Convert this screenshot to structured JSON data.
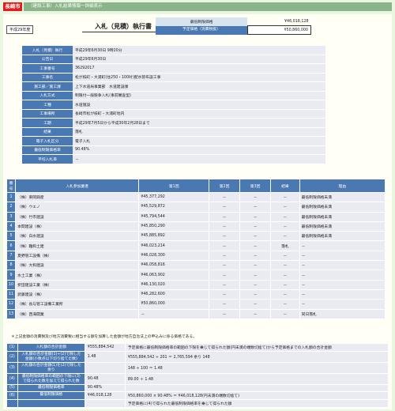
{
  "header": {
    "city": "長崎市",
    "title": "（建設工事）入札結果情報一詳細表示"
  },
  "document": {
    "year": "平成29年度",
    "title": "入札（見積）執行書"
  },
  "prices": {
    "min_label": "最低制限価格",
    "min_value": "¥46,018,128",
    "planned_label": "予定価格（消費税抜）",
    "planned_value": "¥50,860,000"
  },
  "info_rows": [
    {
      "label": "入札（見積）執行",
      "value": "平成29年6月30日 9時20分"
    },
    {
      "label": "公告日",
      "value": "平成29年6月30日"
    },
    {
      "label": "工事番号",
      "value": "36292017"
    },
    {
      "label": "工事名",
      "value": "松が枝町・大浦町(住250・100吋)配水管布設工事"
    },
    {
      "label": "施工部／施工課",
      "value": "上下水道局事業部　水道建設課"
    },
    {
      "label": "入札方式",
      "value": "制限付一般競争入札(事前審査型)"
    },
    {
      "label": "工種",
      "value": "水道施設"
    },
    {
      "label": "工事場所",
      "value": "長崎市松が枝町・大浦町地内"
    },
    {
      "label": "工期",
      "value": "平成29年7月5日から平成30年2月28日まで"
    },
    {
      "label": "結果",
      "value": "落札"
    },
    {
      "label": "電子入札区分",
      "value": "電子入札"
    },
    {
      "label": "最低制限価格率",
      "value": "90.48%"
    },
    {
      "label": "平均入札率",
      "value": "－"
    }
  ],
  "bids": {
    "headers": [
      "番号",
      "入札参加業者",
      "第1回",
      "第2回",
      "第3回",
      "結果",
      "理由"
    ],
    "rows": [
      {
        "no": "1",
        "name": "（株）東岡興産",
        "r1": "¥45,377,292",
        "r2": "－",
        "r3": "－",
        "result": "－",
        "reason": "最低制限価格未満"
      },
      {
        "no": "2",
        "name": "（株）ウエノ",
        "r1": "¥45,529,872",
        "r2": "－",
        "r3": "－",
        "result": "－",
        "reason": "最低制限価格未満"
      },
      {
        "no": "3",
        "name": "（株）竹市建設",
        "r1": "¥45,794,544",
        "r2": "－",
        "r3": "－",
        "result": "－",
        "reason": "最低制限価格未満"
      },
      {
        "no": "4",
        "name": "本間建設（株）",
        "r1": "¥45,850,290",
        "r2": "－",
        "r3": "－",
        "result": "－",
        "reason": "最低制限価格未満"
      },
      {
        "no": "5",
        "name": "（株）白水建設",
        "r1": "¥45,885,892",
        "r2": "－",
        "r3": "－",
        "result": "－",
        "reason": "最低制限価格未満"
      },
      {
        "no": "6",
        "name": "（株）難和土建",
        "r1": "¥46,023,214",
        "r2": "－",
        "r3": "－",
        "result": "落札",
        "reason": "－"
      },
      {
        "no": "7",
        "name": "夏野管工設備（株）",
        "r1": "¥46,028,300",
        "r2": "－",
        "r3": "－",
        "result": "－",
        "reason": "－"
      },
      {
        "no": "8",
        "name": "（株）大和建設",
        "r1": "¥46,058,816",
        "r2": "－",
        "r3": "－",
        "result": "－",
        "reason": "－"
      },
      {
        "no": "9",
        "name": "水土工業（株）",
        "r1": "¥46,063,902",
        "r2": "－",
        "r3": "－",
        "result": "－",
        "reason": "－"
      },
      {
        "no": "10",
        "name": "折田建設工業（株）",
        "r1": "¥46,130,020",
        "r2": "－",
        "r3": "－",
        "result": "－",
        "reason": "－"
      },
      {
        "no": "11",
        "name": "武藤建設（株）",
        "r1": "¥46,282,600",
        "r2": "－",
        "r3": "－",
        "result": "－",
        "reason": "－"
      },
      {
        "no": "12",
        "name": "（株）長与管工設備工業所",
        "r1": "¥50,860,000",
        "r2": "－",
        "r3": "－",
        "result": "－",
        "reason": "－"
      },
      {
        "no": "13",
        "name": "（株）西海開業",
        "r1": "－",
        "r2": "－",
        "r3": "－",
        "result": "－",
        "reason": "同日落札"
      }
    ]
  },
  "note": "＊上記金額の消費税及び地方消費税に相当する額を加算した金額が地方自治法上の申込みに係る価格である。",
  "calc": [
    {
      "no": "(1)",
      "label": "入札額の合計金額",
      "value": "¥555,884,542",
      "detail": "予定価格に最低制限価格率の範囲の下限を乗じて得られた額(円未満の端数切捨て)から予定価格までの入札額の合計金額"
    },
    {
      "no": "(2)",
      "label": "入札額の合計金額(1)÷(2)で除した金額(小数点以下切り捨てた数)",
      "value": "1.48",
      "detail": "¥555,884,542 ÷ 201 ＝ 2,765,594 余り 148"
    },
    {
      "no": "(3)",
      "label": "入札額の合計金額(1)を(2)で除した余り",
      "value": "",
      "detail": "148 ÷ 100 ＝ 1.48"
    },
    {
      "no": "(4)",
      "label": "最低制限価格率の範囲の下限に(3)で得られた数を加えて得られた数",
      "value": "90.48",
      "detail": "89.00 ＋ 1.48"
    },
    {
      "no": "(5)",
      "label": "最低制限価格率",
      "value": "90.48%",
      "detail": ""
    },
    {
      "no": "(6)",
      "label": "最低制限価格",
      "value": "¥46,018,128",
      "detail": "¥50,860,000 × 90.48% ＝ ¥46,018,128(円未満の端数切捨て)"
    },
    {
      "no": "",
      "label": "",
      "value": "",
      "detail": "予定価格に(4)で得られた最低制限価格率を乗じて得られた額"
    }
  ]
}
